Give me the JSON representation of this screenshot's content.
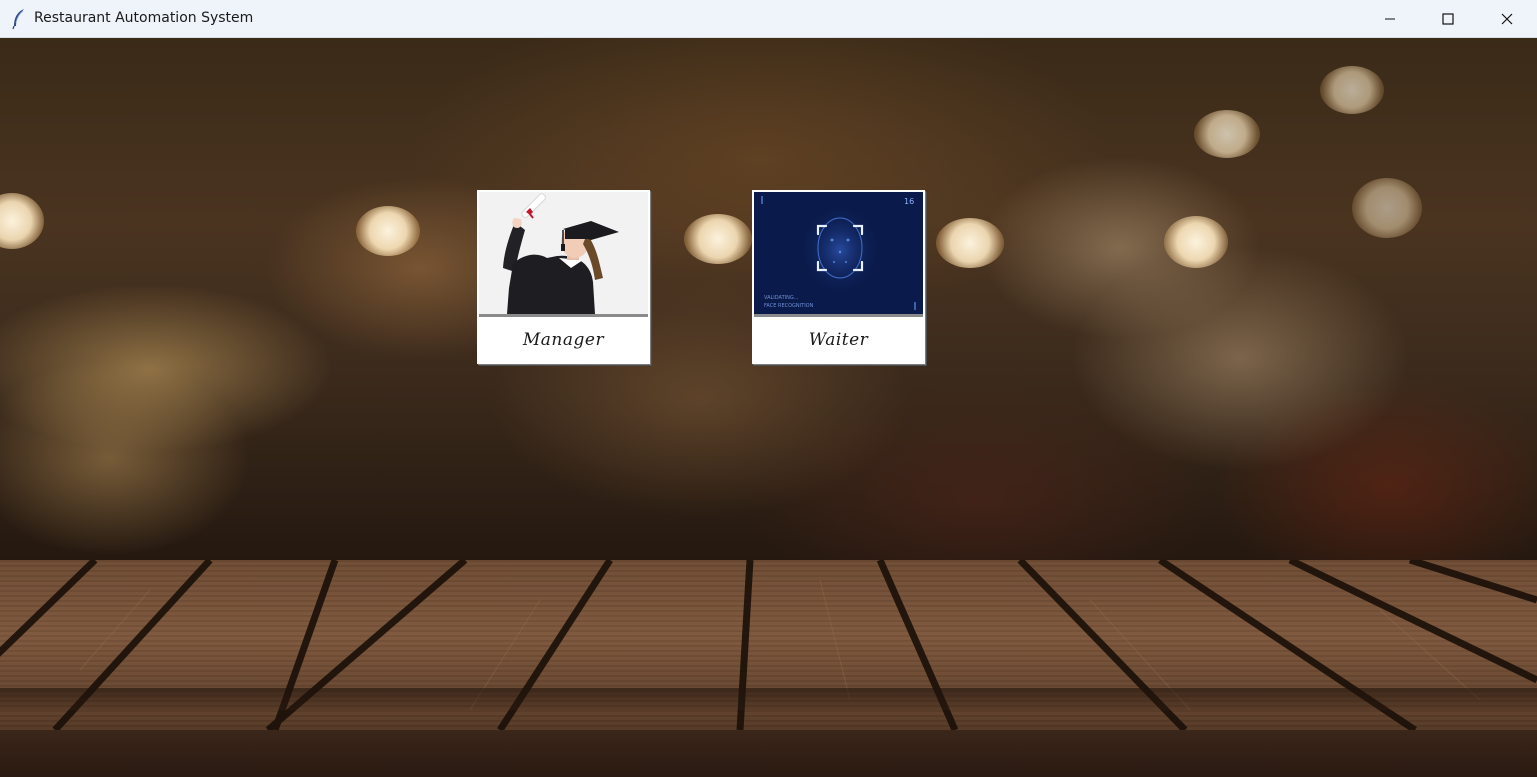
{
  "window": {
    "title": "Restaurant Automation System",
    "app_icon": "feather-icon",
    "controls": [
      "minimize-icon",
      "maximize-icon",
      "close-icon"
    ]
  },
  "roles": [
    {
      "label": "Manager",
      "image": "graduate-illustration"
    },
    {
      "label": "Waiter",
      "image": "face-scan-illustration",
      "image_text": [
        "16",
        "VALIDATING...",
        "FACE RECOGNITION"
      ]
    }
  ],
  "colors": {
    "titlebar": "#eff4fa",
    "face_scan_bg": "#0a1a4a",
    "face_scan_glow": "#6fa8ff"
  }
}
